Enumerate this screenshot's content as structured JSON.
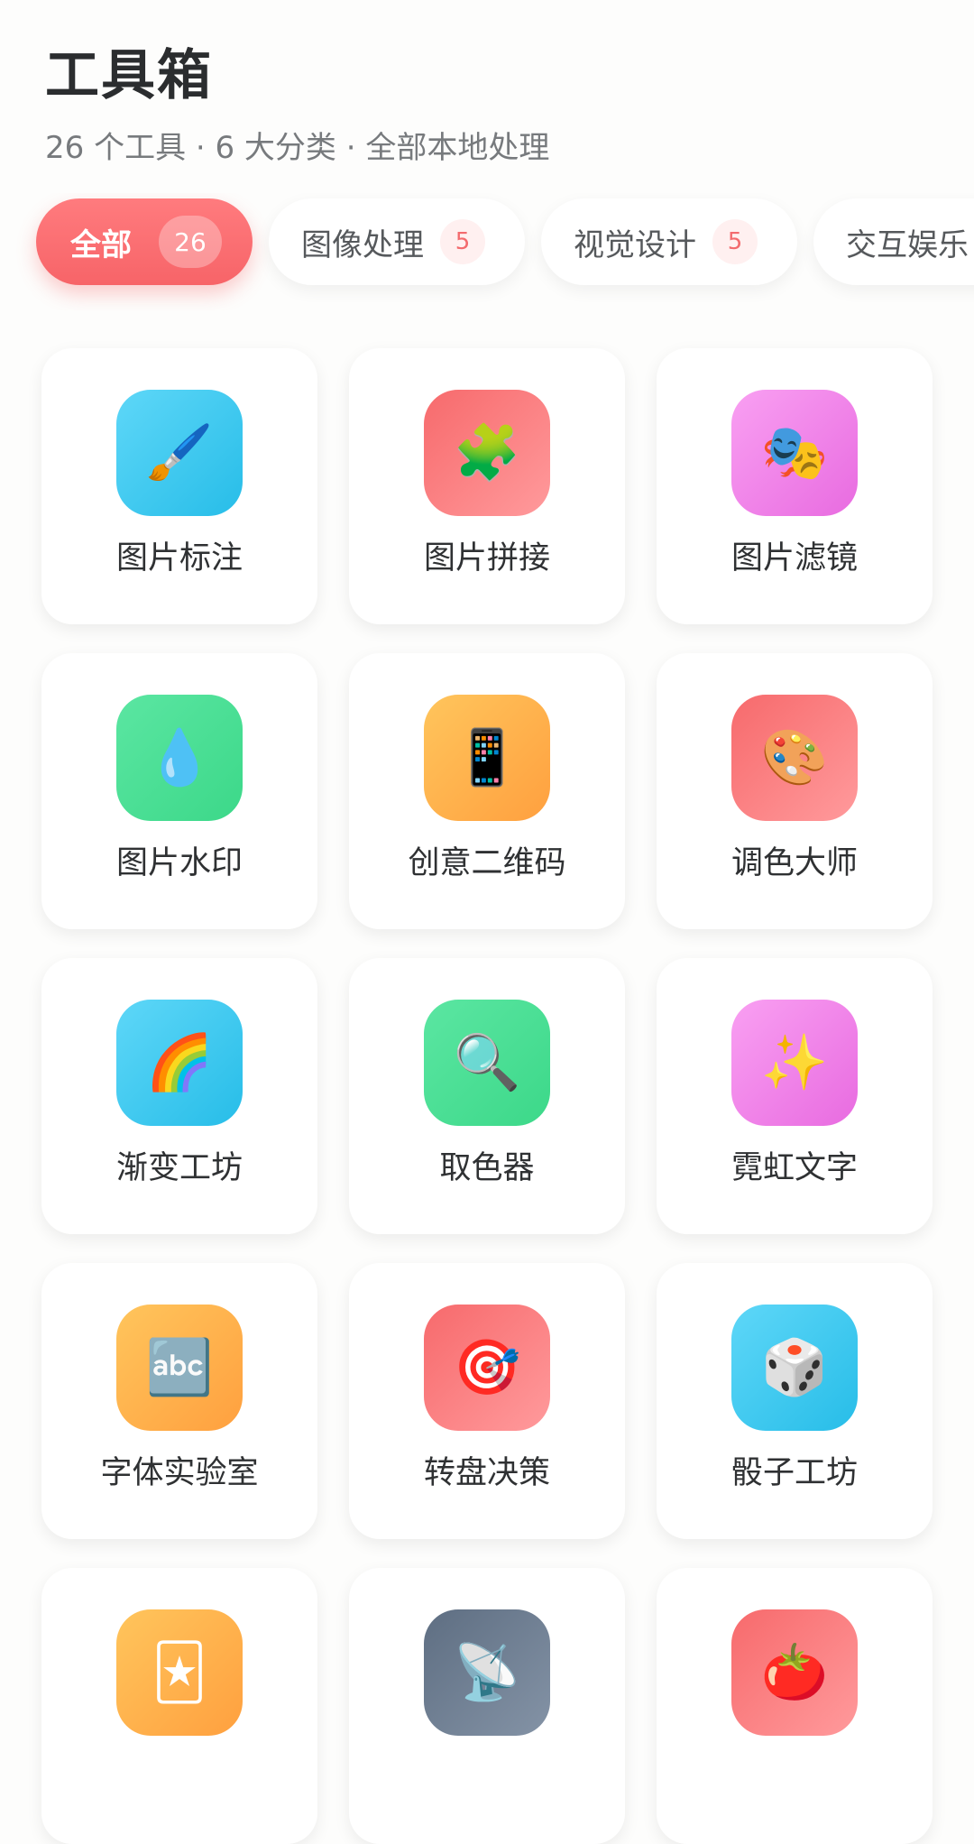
{
  "header": {
    "title": "工具箱",
    "subtitle": "26 个工具 · 6 大分类 · 全部本地处理"
  },
  "tabs": [
    {
      "label": "全部",
      "count": "26",
      "active": true
    },
    {
      "label": "图像处理",
      "count": "5",
      "active": false
    },
    {
      "label": "视觉设计",
      "count": "5",
      "active": false
    },
    {
      "label": "交互娱乐",
      "count": "",
      "active": false
    }
  ],
  "tools": [
    {
      "name": "图片标注",
      "icon": "paintbrush-icon",
      "glyph": "🖌️",
      "color": "cyan"
    },
    {
      "name": "图片拼接",
      "icon": "puzzle-icon",
      "glyph": "🧩",
      "color": "coral"
    },
    {
      "name": "图片滤镜",
      "icon": "theater-masks-icon",
      "glyph": "🎭",
      "color": "pink"
    },
    {
      "name": "图片水印",
      "icon": "droplet-icon",
      "glyph": "💧",
      "color": "green"
    },
    {
      "name": "创意二维码",
      "icon": "mobile-phone-icon",
      "glyph": "📱",
      "color": "orange"
    },
    {
      "name": "调色大师",
      "icon": "palette-icon",
      "glyph": "🎨",
      "color": "coral"
    },
    {
      "name": "渐变工坊",
      "icon": "rainbow-icon",
      "glyph": "🌈",
      "color": "cyan"
    },
    {
      "name": "取色器",
      "icon": "magnifier-icon",
      "glyph": "🔍",
      "color": "green"
    },
    {
      "name": "霓虹文字",
      "icon": "sparkles-icon",
      "glyph": "✨",
      "color": "pink"
    },
    {
      "name": "字体实验室",
      "icon": "abc-icon",
      "glyph": "🔤",
      "color": "orange"
    },
    {
      "name": "转盘决策",
      "icon": "target-icon",
      "glyph": "🎯",
      "color": "coral"
    },
    {
      "name": "骰子工坊",
      "icon": "dice-icon",
      "glyph": "🎲",
      "color": "cyan"
    },
    {
      "name": "",
      "icon": "joker-card-icon",
      "glyph": "🃏",
      "color": "orange"
    },
    {
      "name": "",
      "icon": "satellite-dish-icon",
      "glyph": "📡",
      "color": "slate"
    },
    {
      "name": "",
      "icon": "tomato-icon",
      "glyph": "🍅",
      "color": "coral"
    }
  ],
  "colors": {
    "accent": "#F76468",
    "badge_text": "#F36B6E",
    "cyan": "#27BDE8",
    "coral": "#F76A6C",
    "pink": "#E86BE0",
    "green": "#3CD889",
    "orange": "#FFA03F",
    "slate": "#5E6E82"
  }
}
